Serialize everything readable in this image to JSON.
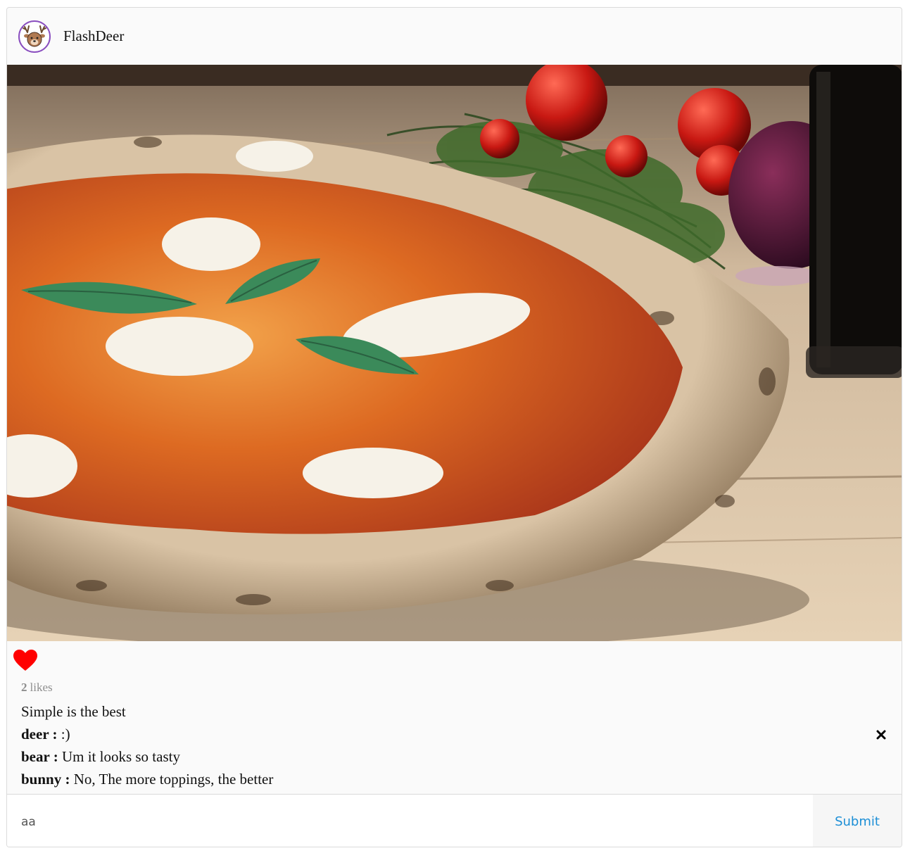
{
  "post": {
    "author": "FlashDeer",
    "likes_count": "2",
    "likes_label": "likes",
    "caption": "Simple is the best",
    "comments": [
      {
        "user": "deer",
        "separator": " : ",
        "text": ":)",
        "deletable": true
      },
      {
        "user": "bear",
        "separator": " : ",
        "text": "Um it looks so tasty",
        "deletable": false
      },
      {
        "user": "bunny",
        "separator": " : ",
        "text": "No, The more toppings, the better",
        "deletable": false
      }
    ],
    "liked": true,
    "image_subject": "margherita pizza with tomatoes and basil on wooden table"
  },
  "comment_form": {
    "input_value": "aa",
    "submit_label": "Submit"
  },
  "colors": {
    "heart": "#ff0000",
    "submit": "#1d8fd6",
    "avatar_ring": "#8a4fbf"
  },
  "icons": {
    "avatar": "deer-icon",
    "like": "heart-icon",
    "delete": "close-icon"
  }
}
